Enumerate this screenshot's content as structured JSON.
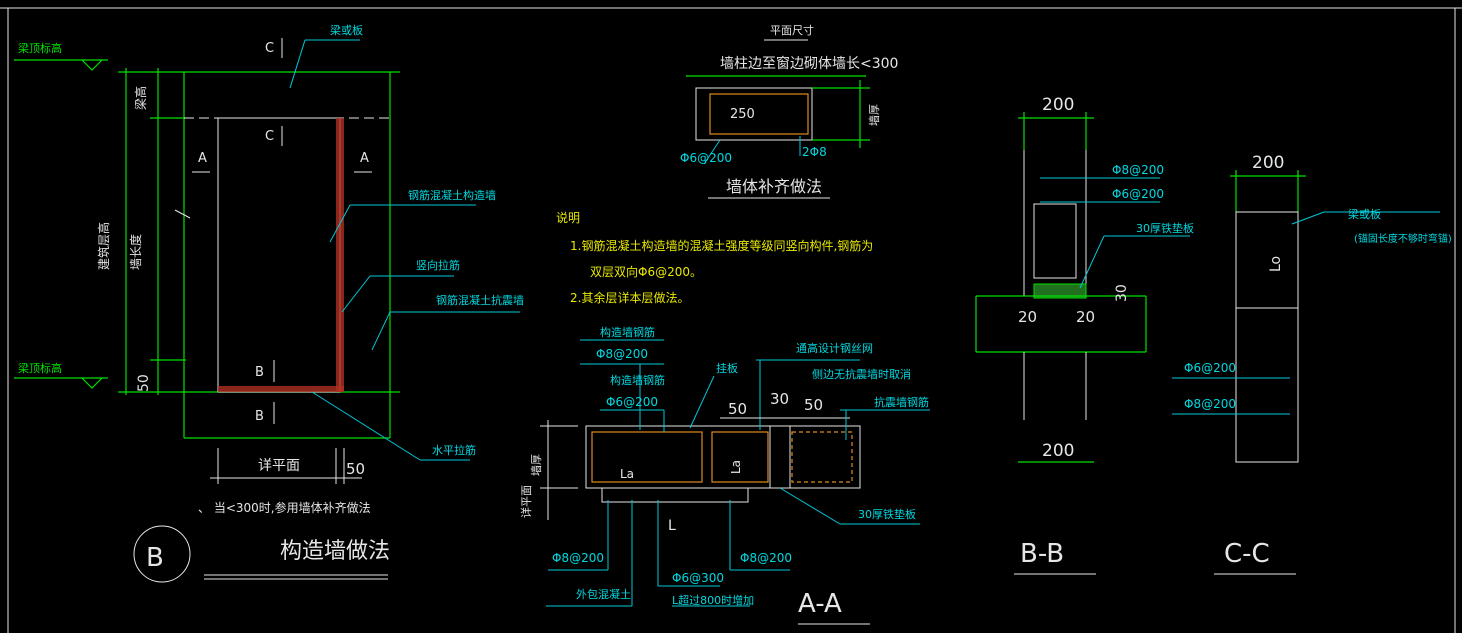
{
  "colors": {
    "background": "#000000",
    "green": "#00e000",
    "cyan": "#00c8d8",
    "white": "#e6e6e6",
    "yellow": "#e8e800",
    "orange": "#e08a20"
  },
  "left": {
    "beam_top_1": "梁顶标高",
    "beam_top_2": "梁顶标高",
    "beam_or_slab": "梁或板",
    "beam_height": "梁高",
    "floor_height": "建筑层高",
    "wall_length": "墙长度",
    "dim_50_v": "50",
    "sec_c1": "C",
    "sec_c2": "C",
    "sec_a1": "A",
    "sec_a2": "A",
    "sec_b1": "B",
    "sec_b2": "B",
    "rc_column": "钢筋混凝土构造墙",
    "vertical_tie": "竖向拉筋",
    "rc_seismic_wall": "钢筋混凝土抗震墙",
    "horizontal_tie": "水平拉筋",
    "detail_plan": "详平面",
    "dim_50_h": "50",
    "note_lt300": "、 当<300时,参用墙体补齐做法",
    "circle_label": "B",
    "title": "构造墙做法"
  },
  "top_center": {
    "plan_dim": "平面尺寸",
    "subtitle": "墙柱边至窗边砌体墙长<300",
    "dim_250": "250",
    "wall_thk": "墙厚",
    "bar_a": "Φ6@200",
    "bar_b": "2Φ8",
    "title": "墙体补齐做法"
  },
  "notes": {
    "heading": "说明",
    "line1": "1.钢筋混凝土构造墙的混凝土强度等级同竖向构件,钢筋为",
    "line2": "双层双向Φ6@200。",
    "line3": "2.其余层详本层做法。"
  },
  "section_aa": {
    "l_wall_bar": "构造墙钢筋",
    "bar1": "Φ8@200",
    "l_wall_bar2": "构造墙钢筋",
    "bar2": "Φ6@200",
    "hang_plate": "挂板",
    "mesh": "通高设计钢丝网",
    "mesh_note": "侧边无抗震墙时取消",
    "d50a": "50",
    "d30": "30",
    "d50b": "50",
    "seismic_bar": "抗震墙钢筋",
    "wall_thk_v": "墙厚",
    "detail_plan_v": "详平面",
    "la1": "La",
    "la2": "La",
    "L": "L",
    "pad": "30厚铁垫板",
    "bar3": "Φ8@200",
    "bar4": "Φ8@200",
    "bar5": "Φ6@300",
    "outer_conc": "外包混凝土",
    "l_note": "L超过800时增加",
    "title": "A-A"
  },
  "section_bb": {
    "top_dim": "200",
    "bar1": "Φ8@200",
    "bar2": "Φ6@200",
    "pad": "30厚铁垫板",
    "d20a": "20",
    "d20b": "20",
    "d30": "30",
    "bottom_dim": "200",
    "title": "B-B"
  },
  "section_cc": {
    "top_dim": "200",
    "beam_or_slab": "梁或板",
    "anchor_note": "(锚固长度不够时弯锚)",
    "lo": "Lo",
    "bar1": "Φ6@200",
    "bar2": "Φ8@200",
    "title": "C-C"
  }
}
